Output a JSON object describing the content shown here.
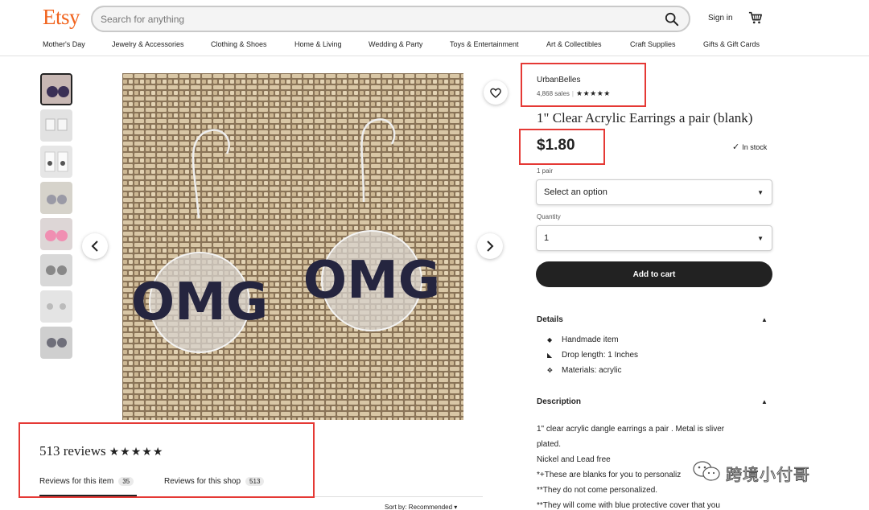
{
  "header": {
    "logo": "Etsy",
    "search_placeholder": "Search for anything",
    "signin": "Sign in",
    "categories": [
      "Mother's Day",
      "Jewelry & Accessories",
      "Clothing & Shoes",
      "Home & Living",
      "Wedding & Party",
      "Toys & Entertainment",
      "Art & Collectibles",
      "Craft Supplies",
      "Gifts & Gift Cards"
    ]
  },
  "gallery": {
    "thumbnail_count": 8,
    "main_image_text": "OMG"
  },
  "shop": {
    "name": "UrbanBelles",
    "sales": "4,868 sales",
    "stars": "★★★★★"
  },
  "listing": {
    "title": "1\" Clear Acrylic Earrings a pair (blank)",
    "price": "$1.80",
    "stock": "In stock",
    "variant_label": "1 pair",
    "variant_value": "Select an option",
    "quantity_label": "Quantity",
    "quantity_value": "1",
    "add_to_cart": "Add to cart"
  },
  "details": {
    "heading": "Details",
    "items": [
      "Handmade item",
      "Drop length: 1 Inches",
      "Materials: acrylic"
    ]
  },
  "description": {
    "heading": "Description",
    "lines": [
      "1\" clear acrylic dangle earrings a pair . Metal is sliver",
      "plated.",
      "Nickel and Lead free",
      "*+These are blanks for you to personaliz",
      "**They do not come personalized.",
      "**They will come with blue protective cover that you"
    ]
  },
  "reviews": {
    "title": "513 reviews",
    "stars": "★★★★★",
    "tab_item_label": "Reviews for this item",
    "tab_item_count": "35",
    "tab_shop_label": "Reviews for this shop",
    "tab_shop_count": "513",
    "sort_label": "Sort by: Recommended"
  },
  "watermark": "跨境小付哥",
  "colors": {
    "brand": "#f1641e",
    "annotation": "#e53935",
    "button": "#222222"
  }
}
